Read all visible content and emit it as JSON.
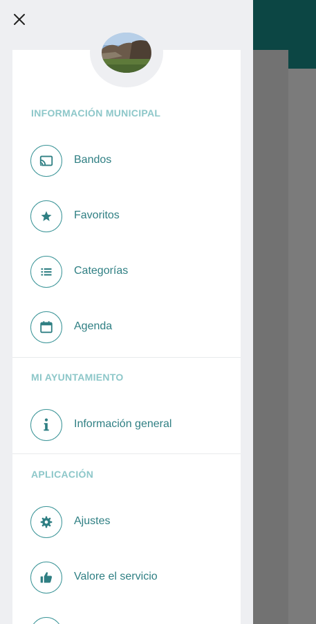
{
  "close_icon": "close-icon",
  "colors": {
    "accent": "#2f7f83",
    "section_title": "#8dc7c9",
    "header_bg": "#0c4644",
    "overlay": "#7a7a7a"
  },
  "sections": {
    "municipal": {
      "title": "INFORMACIÓN MUNICIPAL",
      "items": [
        {
          "label": "Bandos",
          "icon": "cast-icon"
        },
        {
          "label": "Favoritos",
          "icon": "star-icon"
        },
        {
          "label": "Categorías",
          "icon": "list-icon"
        },
        {
          "label": "Agenda",
          "icon": "calendar-icon"
        }
      ]
    },
    "ayuntamiento": {
      "title": "MI AYUNTAMIENTO",
      "items": [
        {
          "label": "Información general",
          "icon": "info-icon"
        }
      ]
    },
    "aplicacion": {
      "title": "APLICACIÓN",
      "items": [
        {
          "label": "Ajustes",
          "icon": "gear-icon"
        },
        {
          "label": "Valore el servicio",
          "icon": "thumbs-up-icon"
        }
      ]
    }
  }
}
